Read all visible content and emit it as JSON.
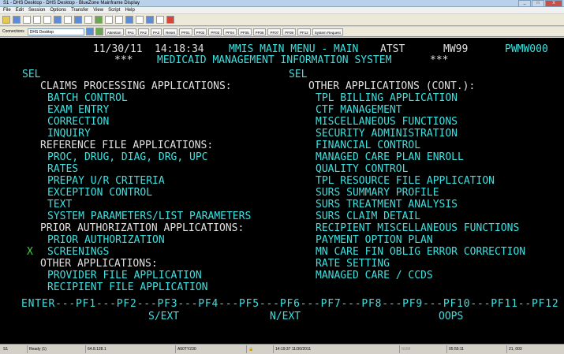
{
  "window": {
    "title": "S1 - DHS Desktop - DHS Desktop - BlueZone Mainframe Display",
    "controls": [
      "_",
      "□",
      "X"
    ]
  },
  "menu": [
    "File",
    "Edit",
    "Session",
    "Options",
    "Transfer",
    "View",
    "Script",
    "Help"
  ],
  "toolbar2": {
    "connections_label": "Connections",
    "session_value": "DHS Desktop",
    "keys": [
      "Attention",
      "PA1",
      "PA2",
      "PA3",
      "Reset",
      "PF01",
      "PF02",
      "PF03",
      "PF04",
      "PF05",
      "PF06",
      "PF07",
      "PF08",
      "PF12",
      "System Request"
    ]
  },
  "screen": {
    "date": "11/30/11",
    "time": "14:18:34",
    "menu_title": "MMIS MAIN MENU - MAIN",
    "region": "ATST",
    "terminal": "MW99",
    "screen_id": "PWMW000",
    "stars_left": "***",
    "system_title": "MEDICAID MANAGEMENT INFORMATION SYSTEM",
    "stars_right": "***",
    "sel_left": "SEL",
    "sel_right": "SEL",
    "left_items": {
      "claims_header": "CLAIMS PROCESSING APPLICATIONS:",
      "batch_control": "BATCH CONTROL",
      "exam_entry": "EXAM ENTRY",
      "correction": "CORRECTION",
      "inquiry": "INQUIRY",
      "ref_header": "REFERENCE FILE APPLICATIONS:",
      "proc_drug": "PROC, DRUG, DIAG, DRG, UPC",
      "rates": "RATES",
      "prepay": "PREPAY U/R CRITERIA",
      "exception": "EXCEPTION CONTROL",
      "text": "TEXT",
      "sysparams": "SYSTEM PARAMETERS/LIST PARAMETERS",
      "prior_header": "PRIOR AUTHORIZATION APPLICATIONS:",
      "prior_auth": "PRIOR AUTHORIZATION",
      "screenings": "SCREENINGS",
      "other_header": "OTHER APPLICATIONS:",
      "provider_file": "PROVIDER FILE APPLICATION",
      "recipient_file": "RECIPIENT FILE APPLICATION"
    },
    "selection_mark": "X",
    "right_items": {
      "other_cont_header": "OTHER APPLICATIONS (CONT.):",
      "tpl_billing": "TPL BILLING APPLICATION",
      "ctf": "CTF MANAGEMENT",
      "misc": "MISCELLANEOUS FUNCTIONS",
      "security": "SECURITY ADMINISTRATION",
      "financial": "FINANCIAL CONTROL",
      "managed_care_enroll": "MANAGED CARE PLAN ENROLL",
      "quality": "QUALITY CONTROL",
      "tpl_resource": "TPL RESOURCE FILE APPLICATION",
      "surs_summary": "SURS SUMMARY PROFILE",
      "surs_treatment": "SURS TREATMENT ANALYSIS",
      "surs_claim": "SURS CLAIM DETAIL",
      "recipient_misc": "RECIPIENT MISCELLANEOUS FUNCTIONS",
      "payment_option": "PAYMENT OPTION PLAN",
      "mn_care": "MN CARE FIN OBLIG ERROR CORRECTION",
      "rate_setting": "RATE SETTING",
      "managed_ccds": "MANAGED CARE / CCDS"
    },
    "pf_line": "ENTER---PF1---PF2---PF3---PF4---PF5---PF6---PF7---PF8---PF9---PF10---PF11--PF12",
    "pf3_label": "S/EXT",
    "pf6_label": "N/EXT",
    "pf10_label": "OOPS"
  },
  "status": {
    "session": "S1",
    "state": "Ready (1)",
    "ip": "64.8.128.1",
    "host": "A50TY230",
    "datetime": "14:19:37 11/30/2011",
    "numlock": "NUM",
    "clock": "05:55:11",
    "cursor": "21, 003"
  }
}
